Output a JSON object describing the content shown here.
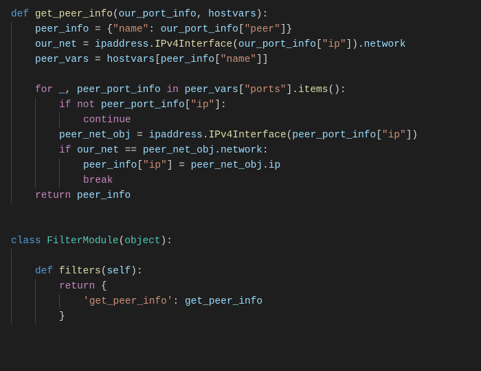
{
  "code": {
    "lines": [
      {
        "indent": 0,
        "tokens": [
          {
            "t": "def ",
            "c": "kw"
          },
          {
            "t": "get_peer_info",
            "c": "fn"
          },
          {
            "t": "(",
            "c": "pun"
          },
          {
            "t": "our_port_info",
            "c": "var"
          },
          {
            "t": ", ",
            "c": "pun"
          },
          {
            "t": "hostvars",
            "c": "var"
          },
          {
            "t": "):",
            "c": "pun"
          }
        ]
      },
      {
        "indent": 1,
        "tokens": [
          {
            "t": "peer_info",
            "c": "var"
          },
          {
            "t": " = {",
            "c": "pun"
          },
          {
            "t": "\"name\"",
            "c": "str"
          },
          {
            "t": ": ",
            "c": "pun"
          },
          {
            "t": "our_port_info",
            "c": "var"
          },
          {
            "t": "[",
            "c": "pun"
          },
          {
            "t": "\"peer\"",
            "c": "str"
          },
          {
            "t": "]}",
            "c": "pun"
          }
        ]
      },
      {
        "indent": 1,
        "tokens": [
          {
            "t": "our_net",
            "c": "var"
          },
          {
            "t": " = ",
            "c": "pun"
          },
          {
            "t": "ipaddress",
            "c": "var"
          },
          {
            "t": ".",
            "c": "pun"
          },
          {
            "t": "IPv4Interface",
            "c": "fn"
          },
          {
            "t": "(",
            "c": "pun"
          },
          {
            "t": "our_port_info",
            "c": "var"
          },
          {
            "t": "[",
            "c": "pun"
          },
          {
            "t": "\"ip\"",
            "c": "str"
          },
          {
            "t": "]).",
            "c": "pun"
          },
          {
            "t": "network",
            "c": "var"
          }
        ]
      },
      {
        "indent": 1,
        "tokens": [
          {
            "t": "peer_vars",
            "c": "var"
          },
          {
            "t": " = ",
            "c": "pun"
          },
          {
            "t": "hostvars",
            "c": "var"
          },
          {
            "t": "[",
            "c": "pun"
          },
          {
            "t": "peer_info",
            "c": "var"
          },
          {
            "t": "[",
            "c": "pun"
          },
          {
            "t": "\"name\"",
            "c": "str"
          },
          {
            "t": "]]",
            "c": "pun"
          }
        ]
      },
      {
        "indent": 1,
        "blank": true,
        "tokens": []
      },
      {
        "indent": 1,
        "tokens": [
          {
            "t": "for ",
            "c": "kw2"
          },
          {
            "t": "_",
            "c": "var"
          },
          {
            "t": ", ",
            "c": "pun"
          },
          {
            "t": "peer_port_info",
            "c": "var"
          },
          {
            "t": " in ",
            "c": "kw2"
          },
          {
            "t": "peer_vars",
            "c": "var"
          },
          {
            "t": "[",
            "c": "pun"
          },
          {
            "t": "\"ports\"",
            "c": "str"
          },
          {
            "t": "].",
            "c": "pun"
          },
          {
            "t": "items",
            "c": "fn"
          },
          {
            "t": "():",
            "c": "pun"
          }
        ]
      },
      {
        "indent": 2,
        "tokens": [
          {
            "t": "if ",
            "c": "kw2"
          },
          {
            "t": "not ",
            "c": "kw2"
          },
          {
            "t": "peer_port_info",
            "c": "var"
          },
          {
            "t": "[",
            "c": "pun"
          },
          {
            "t": "\"ip\"",
            "c": "str"
          },
          {
            "t": "]:",
            "c": "pun"
          }
        ]
      },
      {
        "indent": 3,
        "tokens": [
          {
            "t": "continue",
            "c": "kw2"
          }
        ]
      },
      {
        "indent": 2,
        "tokens": [
          {
            "t": "peer_net_obj",
            "c": "var"
          },
          {
            "t": " = ",
            "c": "pun"
          },
          {
            "t": "ipaddress",
            "c": "var"
          },
          {
            "t": ".",
            "c": "pun"
          },
          {
            "t": "IPv4Interface",
            "c": "fn"
          },
          {
            "t": "(",
            "c": "pun"
          },
          {
            "t": "peer_port_info",
            "c": "var"
          },
          {
            "t": "[",
            "c": "pun"
          },
          {
            "t": "\"ip\"",
            "c": "str"
          },
          {
            "t": "])",
            "c": "pun"
          }
        ]
      },
      {
        "indent": 2,
        "tokens": [
          {
            "t": "if ",
            "c": "kw2"
          },
          {
            "t": "our_net",
            "c": "var"
          },
          {
            "t": " == ",
            "c": "pun"
          },
          {
            "t": "peer_net_obj",
            "c": "var"
          },
          {
            "t": ".",
            "c": "pun"
          },
          {
            "t": "network",
            "c": "var"
          },
          {
            "t": ":",
            "c": "pun"
          }
        ]
      },
      {
        "indent": 3,
        "tokens": [
          {
            "t": "peer_info",
            "c": "var"
          },
          {
            "t": "[",
            "c": "pun"
          },
          {
            "t": "\"ip\"",
            "c": "str"
          },
          {
            "t": "] = ",
            "c": "pun"
          },
          {
            "t": "peer_net_obj",
            "c": "var"
          },
          {
            "t": ".",
            "c": "pun"
          },
          {
            "t": "ip",
            "c": "var"
          }
        ]
      },
      {
        "indent": 3,
        "tokens": [
          {
            "t": "break",
            "c": "kw2"
          }
        ]
      },
      {
        "indent": 1,
        "tokens": [
          {
            "t": "return ",
            "c": "kw2"
          },
          {
            "t": "peer_info",
            "c": "var"
          }
        ]
      },
      {
        "indent": 0,
        "blank": true,
        "tokens": []
      },
      {
        "indent": 0,
        "blank": true,
        "tokens": []
      },
      {
        "indent": 0,
        "tokens": [
          {
            "t": "class ",
            "c": "kw"
          },
          {
            "t": "FilterModule",
            "c": "cls"
          },
          {
            "t": "(",
            "c": "pun"
          },
          {
            "t": "object",
            "c": "cls"
          },
          {
            "t": "):",
            "c": "pun"
          }
        ]
      },
      {
        "indent": 1,
        "blank": true,
        "tokens": []
      },
      {
        "indent": 1,
        "tokens": [
          {
            "t": "def ",
            "c": "kw"
          },
          {
            "t": "filters",
            "c": "fn"
          },
          {
            "t": "(",
            "c": "pun"
          },
          {
            "t": "self",
            "c": "var"
          },
          {
            "t": "):",
            "c": "pun"
          }
        ]
      },
      {
        "indent": 2,
        "tokens": [
          {
            "t": "return ",
            "c": "kw2"
          },
          {
            "t": "{",
            "c": "pun"
          }
        ]
      },
      {
        "indent": 3,
        "tokens": [
          {
            "t": "'get_peer_info'",
            "c": "str"
          },
          {
            "t": ": ",
            "c": "pun"
          },
          {
            "t": "get_peer_info",
            "c": "var"
          }
        ]
      },
      {
        "indent": 2,
        "tokens": [
          {
            "t": "}",
            "c": "pun"
          }
        ]
      }
    ]
  }
}
